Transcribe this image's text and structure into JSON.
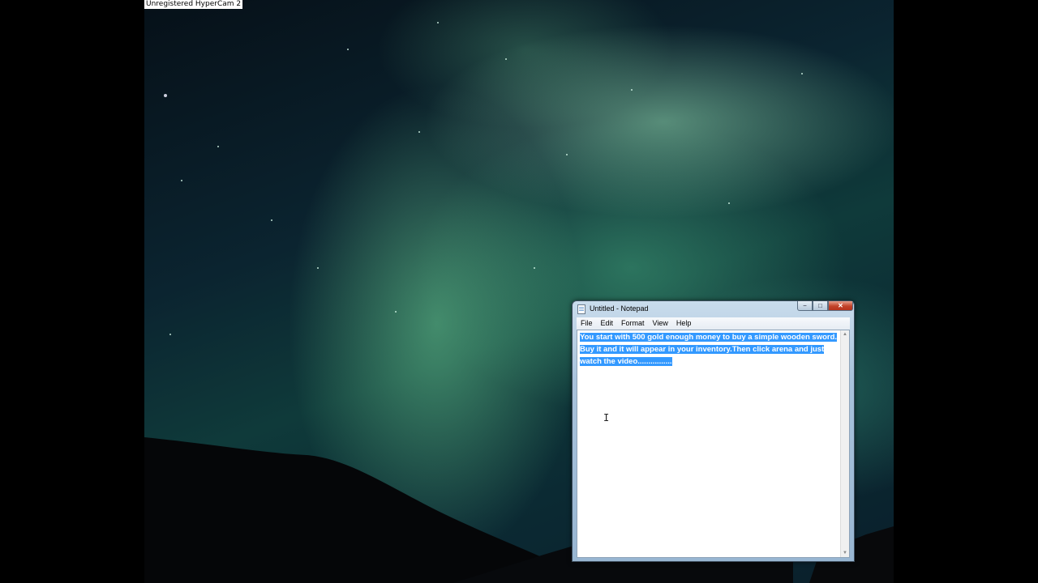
{
  "recorder": {
    "watermark": "Unregistered HyperCam 2"
  },
  "notepad": {
    "title": "Untitled - Notepad",
    "controls": {
      "minimize": "−",
      "maximize": "□",
      "close": "✕"
    },
    "menu": [
      "File",
      "Edit",
      "Format",
      "View",
      "Help"
    ],
    "text_lines": [
      "You start with 500 gold enough money to buy a simple wooden sword.",
      "Buy it and it will appear in your inventory.Then click arena and just",
      "watch the video................"
    ],
    "selection_color": "#3399ff",
    "scroll": {
      "up": "▲",
      "down": "▼"
    }
  },
  "mouse": {
    "cursor": "I"
  },
  "icons": {
    "app": "notepad-icon",
    "cursor": "text-cursor-icon"
  }
}
